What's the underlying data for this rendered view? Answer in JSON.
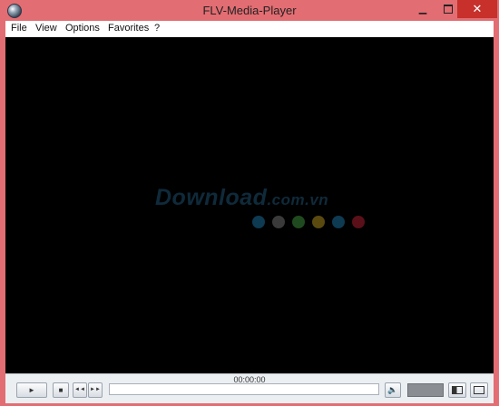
{
  "window": {
    "title": "FLV-Media-Player"
  },
  "menu": {
    "items": [
      "File",
      "View",
      "Options",
      "Favorites",
      "?"
    ]
  },
  "video": {
    "watermark": {
      "main": "Download",
      "domain": ".com.vn"
    },
    "watermark_dot_colors": [
      "#0e3a52",
      "#3a3a3a",
      "#1f4a1f",
      "#5a4a10",
      "#0e3a52",
      "#5a1018"
    ]
  },
  "controls": {
    "time": "00:00:00",
    "play_glyph": "►",
    "stop_glyph": "■",
    "prev_glyph": "◄◄",
    "next_glyph": "►►",
    "volume_glyph": "🔈"
  }
}
